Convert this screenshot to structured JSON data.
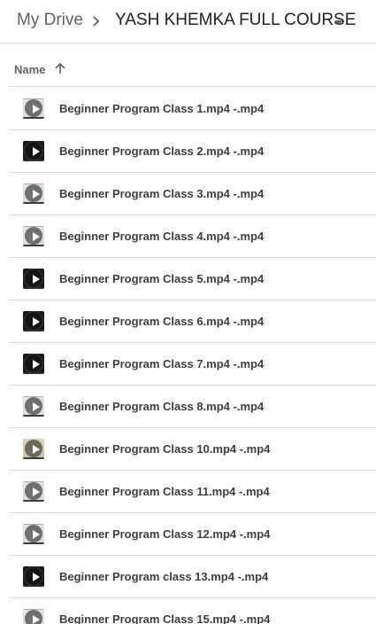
{
  "breadcrumb": {
    "root_label": "My Drive",
    "separator_icon": "chevron-right-icon",
    "current_folder": "YASH KHEMKA FULL COURSE",
    "dropdown_icon": "caret-down-icon"
  },
  "list_header": {
    "name_label": "Name",
    "sort_icon": "arrow-up-icon"
  },
  "files": [
    {
      "name": "Beginner Program Class 1.mp4 -.mp4",
      "thumb": "light",
      "icon": "video-play-icon"
    },
    {
      "name": "Beginner Program Class 2.mp4 -.mp4",
      "thumb": "dark",
      "icon": "video-play-icon"
    },
    {
      "name": "Beginner Program Class 3.mp4 -.mp4",
      "thumb": "light",
      "icon": "video-play-icon"
    },
    {
      "name": "Beginner Program Class 4.mp4 -.mp4",
      "thumb": "light",
      "icon": "video-play-icon"
    },
    {
      "name": "Beginner Program Class 5.mp4 -.mp4",
      "thumb": "dark",
      "icon": "video-play-icon"
    },
    {
      "name": "Beginner Program Class 6.mp4 -.mp4",
      "thumb": "dark",
      "icon": "video-play-icon"
    },
    {
      "name": "Beginner Program Class 7.mp4 -.mp4",
      "thumb": "dark",
      "icon": "video-play-icon"
    },
    {
      "name": "Beginner Program Class 8.mp4 -.mp4",
      "thumb": "light",
      "icon": "video-play-icon"
    },
    {
      "name": "Beginner Program Class 10.mp4 -.mp4",
      "thumb": "olive",
      "icon": "video-play-icon"
    },
    {
      "name": "Beginner Program Class 11.mp4 -.mp4",
      "thumb": "light",
      "icon": "video-play-icon"
    },
    {
      "name": "Beginner Program Class 12.mp4 -.mp4",
      "thumb": "light",
      "icon": "video-play-icon"
    },
    {
      "name": "Beginner Program class 13.mp4 -.mp4",
      "thumb": "dark",
      "icon": "video-play-icon"
    },
    {
      "name": "Beginner Program Class 15.mp4 -.mp4",
      "thumb": "light",
      "icon": "video-play-icon"
    }
  ],
  "colors": {
    "divider": "#dadce0",
    "text_primary": "#202124",
    "text_secondary": "#5f6368",
    "file_text": "#3c4043"
  }
}
